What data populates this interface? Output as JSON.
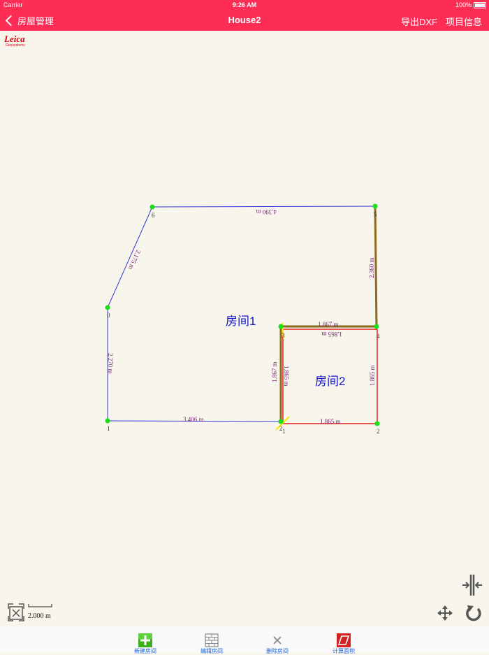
{
  "status": {
    "carrier": "Carrier",
    "time": "9:26 AM",
    "battery": "100%"
  },
  "nav": {
    "back_label": "房屋管理",
    "title": "House2",
    "export_label": "导出DXF",
    "info_label": "项目信息"
  },
  "logo": {
    "brand": "Leica",
    "sub": "Geosystems"
  },
  "rooms": [
    {
      "name": "房间1",
      "color": "#1414c8"
    },
    {
      "name": "房间2",
      "color": "#1414c8"
    }
  ],
  "room1": {
    "vertex_labels": [
      "0",
      "1",
      "2",
      "3",
      "4",
      "5",
      "6"
    ],
    "edge_labels": [
      "2.270 m",
      "3.406 m",
      "1.867 m",
      "1.867 m",
      "2.360 m",
      "4.390 m",
      "2.175 m"
    ],
    "line_color": "#3535d8"
  },
  "room2": {
    "vertex_labels": [
      "0",
      "1",
      "2",
      "3"
    ],
    "edge_labels": [
      "1.865 m",
      "1.865 m",
      "1.865 m",
      "1.865 m"
    ],
    "line_color": "#e02020"
  },
  "scale": {
    "label": "2.000 m"
  },
  "toolbar": {
    "new_room": "新建房间",
    "edit_room": "编辑房间",
    "delete_room": "删除房间",
    "calc_area": "计算面积"
  },
  "colors": {
    "header": "#fd2d55",
    "point": "#19e019",
    "dimension_text": "#7a1f7a",
    "shared_wall": "#8b6a1e"
  }
}
